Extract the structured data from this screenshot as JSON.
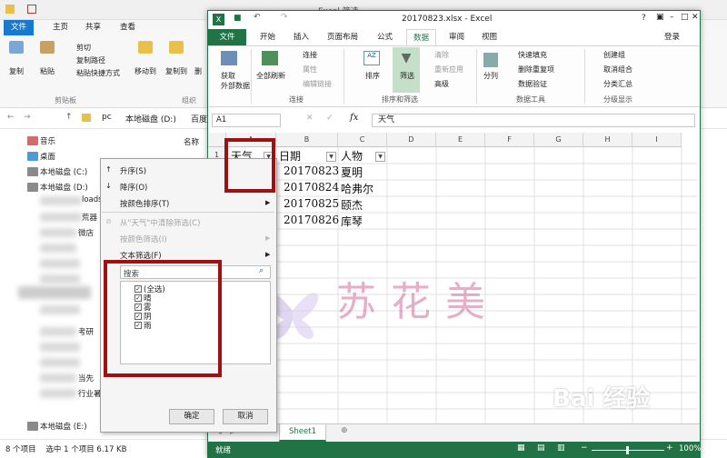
{
  "explorer": {
    "title": "Excel 筛选",
    "tabs": [
      "文件",
      "主页",
      "共享",
      "查看"
    ],
    "ribbon": {
      "copy": "复制",
      "paste": "粘贴",
      "cut": "剪切",
      "copy_path": "复制路径",
      "paste_shortcut": "粘贴快捷方式",
      "clipboard_group": "剪贴板",
      "move_to": "移动到",
      "copy_to": "复制到",
      "delete": "删",
      "organize_group": "组织"
    },
    "address": [
      "pc",
      "本地磁盘 (D:)",
      "百度经"
    ],
    "sidebar": [
      {
        "label": "音乐"
      },
      {
        "label": "桌面"
      },
      {
        "label": "本地磁盘 (C:)"
      },
      {
        "label": "本地磁盘 (D:)"
      }
    ],
    "partial_labels": [
      "loads",
      "荒器",
      "微店",
      "考研",
      "当先",
      "行业暑"
    ],
    "column_header": "名称",
    "disk_e": "本地磁盘 (E:)",
    "status": "8 个项目    选中 1 个项目 6.17 KB"
  },
  "menu": {
    "items": [
      {
        "label": "升序(S)",
        "disabled": false,
        "arrow": false
      },
      {
        "label": "降序(O)",
        "disabled": false,
        "arrow": false
      },
      {
        "label": "按颜色排序(T)",
        "disabled": false,
        "arrow": true
      },
      {
        "label": "从\"天气\"中清除筛选(C)",
        "disabled": true,
        "arrow": false
      },
      {
        "label": "按颜色筛选(I)",
        "disabled": true,
        "arrow": true
      },
      {
        "label": "文本筛选(F)",
        "disabled": false,
        "arrow": true
      }
    ],
    "search_placeholder": "搜索",
    "checklist": [
      {
        "label": "(全选)",
        "checked": true
      },
      {
        "label": "晴",
        "checked": true
      },
      {
        "label": "雾",
        "checked": true
      },
      {
        "label": "阴",
        "checked": true
      },
      {
        "label": "雨",
        "checked": true
      }
    ],
    "ok": "确定",
    "cancel": "取消"
  },
  "excel": {
    "title": "20170823.xlsx - Excel",
    "title_bg": "Excel筛选",
    "tabs": [
      "文件",
      "开始",
      "插入",
      "页面布局",
      "公式",
      "数据",
      "审阅",
      "视图"
    ],
    "active_tab": "数据",
    "login": "登录",
    "ribbon": {
      "get_external": "获取\n外部数据",
      "refresh_all": "全部刷新",
      "connections": "连接",
      "properties": "属性",
      "edit_links": "编辑链接",
      "connections_group": "连接",
      "sort": "排序",
      "filter": "筛选",
      "clear": "清除",
      "reapply": "重新应用",
      "advanced": "高级",
      "sort_filter_group": "排序和筛选",
      "text_to_columns": "分列",
      "flash_fill": "快速填充",
      "remove_dup": "删除重复项",
      "validation": "数据验证",
      "data_tools_group": "数据工具",
      "group": "创建组",
      "ungroup": "取消组合",
      "subtotal": "分类汇总",
      "outline_group": "分级显示"
    },
    "name_box": "A1",
    "formula": "天气",
    "columns": [
      "A",
      "B",
      "C",
      "D",
      "E",
      "F",
      "G",
      "H",
      "I"
    ],
    "rows": [
      "1",
      "2",
      "3",
      "4",
      "5"
    ],
    "headers": [
      "天气",
      "日期",
      "人物"
    ],
    "data": [
      {
        "date": "20170823",
        "person": "夏明"
      },
      {
        "date": "20170824",
        "person": "哈弗尔"
      },
      {
        "date": "20170825",
        "person": "颐杰"
      },
      {
        "date": "20170826",
        "person": "库琴"
      }
    ],
    "sheet": "Sheet1",
    "status": "就绪",
    "zoom": "100%"
  },
  "watermark": "苏花美",
  "baidu": "Bai 经验",
  "colors": {
    "excel_green": "#217346",
    "highlight": "#a01010",
    "explorer_blue": "#1979ca"
  }
}
